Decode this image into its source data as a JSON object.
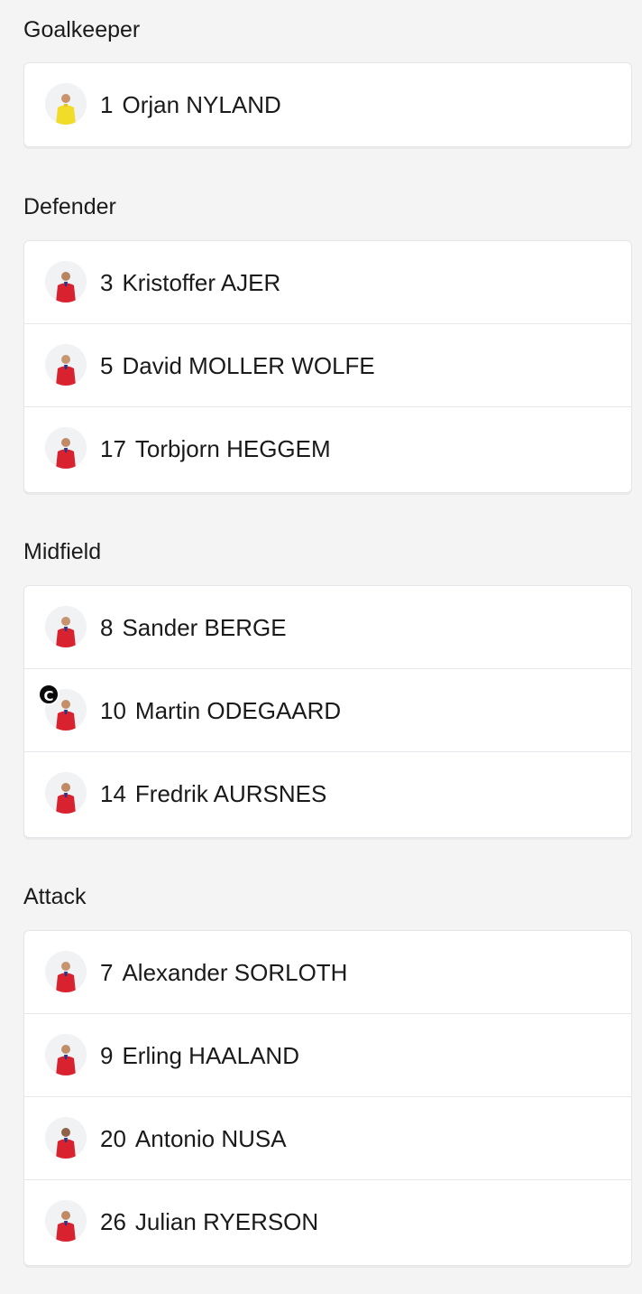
{
  "sections": [
    {
      "title": "Goalkeeper",
      "players": [
        {
          "number": "1",
          "name": "Orjan NYLAND",
          "kit": "goalkeeper",
          "captain": false
        }
      ]
    },
    {
      "title": "Defender",
      "players": [
        {
          "number": "3",
          "name": "Kristoffer AJER",
          "kit": "outfield",
          "captain": false
        },
        {
          "number": "5",
          "name": "David MOLLER WOLFE",
          "kit": "outfield",
          "captain": false
        },
        {
          "number": "17",
          "name": "Torbjorn HEGGEM",
          "kit": "outfield",
          "captain": false
        }
      ]
    },
    {
      "title": "Midfield",
      "players": [
        {
          "number": "8",
          "name": "Sander BERGE",
          "kit": "outfield",
          "captain": false
        },
        {
          "number": "10",
          "name": "Martin ODEGAARD",
          "kit": "outfield",
          "captain": true,
          "captain_label": "C"
        },
        {
          "number": "14",
          "name": "Fredrik AURSNES",
          "kit": "outfield",
          "captain": false
        }
      ]
    },
    {
      "title": "Attack",
      "players": [
        {
          "number": "7",
          "name": "Alexander SORLOTH",
          "kit": "outfield",
          "captain": false
        },
        {
          "number": "9",
          "name": "Erling HAALAND",
          "kit": "outfield",
          "captain": false
        },
        {
          "number": "20",
          "name": "Antonio NUSA",
          "kit": "outfield",
          "captain": false
        },
        {
          "number": "26",
          "name": "Julian RYERSON",
          "kit": "outfield",
          "captain": false
        }
      ]
    }
  ],
  "colors": {
    "background": "#f4f4f5",
    "card": "#ffffff",
    "outfield_kit": "#d9222f",
    "goalkeeper_kit": "#f1dc2a",
    "kit_trim": "#1f3a8a",
    "captain_badge": "#0a0a0a"
  },
  "icons": {
    "player_avatar": "player-photo-icon",
    "captain": "captain-badge-icon"
  }
}
